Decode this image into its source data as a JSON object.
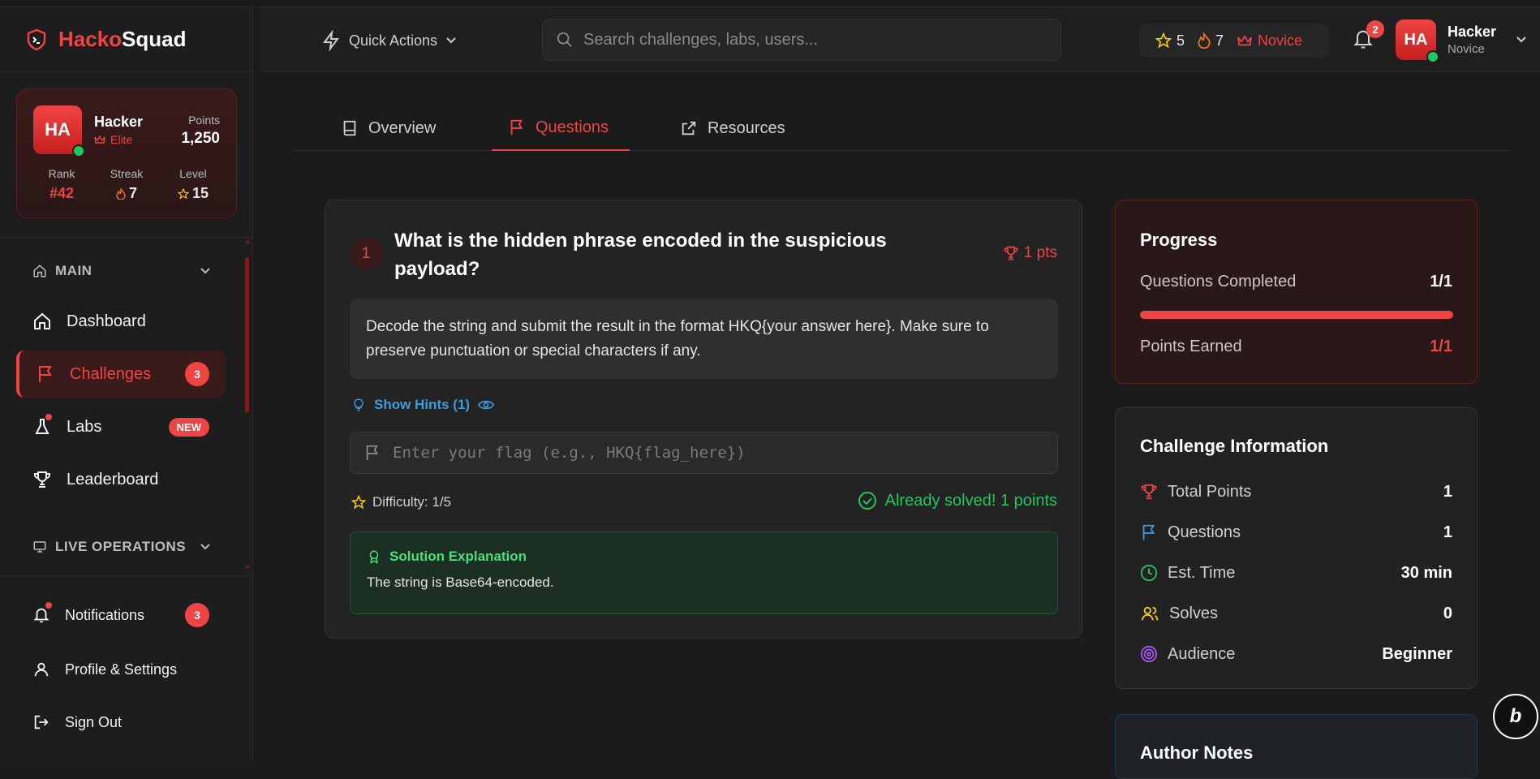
{
  "brand": {
    "part1": "Hacko",
    "part2": "Squad"
  },
  "user_card": {
    "avatar": "HA",
    "name": "Hacker",
    "tier": "Elite",
    "points_label": "Points",
    "points": "1,250",
    "stats": [
      {
        "label": "Rank",
        "value": "#42"
      },
      {
        "label": "Streak",
        "value": "7"
      },
      {
        "label": "Level",
        "value": "15"
      }
    ]
  },
  "sidebar": {
    "main_section": "MAIN",
    "items": [
      {
        "label": "Dashboard"
      },
      {
        "label": "Challenges",
        "badge": "3"
      },
      {
        "label": "Labs",
        "badge": "NEW"
      },
      {
        "label": "Leaderboard"
      }
    ],
    "live_section": "LIVE OPERATIONS",
    "bottom": [
      {
        "label": "Notifications",
        "badge": "3"
      },
      {
        "label": "Profile & Settings"
      },
      {
        "label": "Sign Out"
      }
    ]
  },
  "header": {
    "quick_actions": "Quick Actions",
    "search_placeholder": "Search challenges, labs, users...",
    "stars": "5",
    "streak": "7",
    "rank": "Novice",
    "notif_count": "2",
    "user": {
      "avatar": "HA",
      "name": "Hacker",
      "rank": "Novice"
    }
  },
  "tabs": [
    {
      "label": "Overview"
    },
    {
      "label": "Questions"
    },
    {
      "label": "Resources"
    }
  ],
  "question": {
    "number": "1",
    "title": "What is the hidden phrase encoded in the suspicious payload?",
    "points": "1 pts",
    "description": "Decode the string and submit the result in the format HKQ{your answer here}. Make sure to preserve punctuation or special characters if any.",
    "hints": "Show Hints (1)",
    "flag_placeholder": "Enter your flag (e.g., HKQ{flag_here})",
    "difficulty": "Difficulty: 1/5",
    "solved": "Already solved! 1 points",
    "solution_title": "Solution Explanation",
    "solution_body": "The string is Base64-encoded."
  },
  "progress": {
    "title": "Progress",
    "questions_label": "Questions Completed",
    "questions_value": "1/1",
    "completion_fraction": 1.0,
    "points_label": "Points Earned",
    "points_value": "1/1"
  },
  "challenge_info": {
    "title": "Challenge Information",
    "rows": [
      {
        "label": "Total Points",
        "value": "1"
      },
      {
        "label": "Questions",
        "value": "1"
      },
      {
        "label": "Est. Time",
        "value": "30 min"
      },
      {
        "label": "Solves",
        "value": "0"
      },
      {
        "label": "Audience",
        "value": "Beginner"
      }
    ]
  },
  "author_notes": {
    "title": "Author Notes"
  },
  "colors": {
    "accent": "#ef4444",
    "success": "#22c55e",
    "link": "#3b9be0",
    "warning": "#facc15"
  }
}
